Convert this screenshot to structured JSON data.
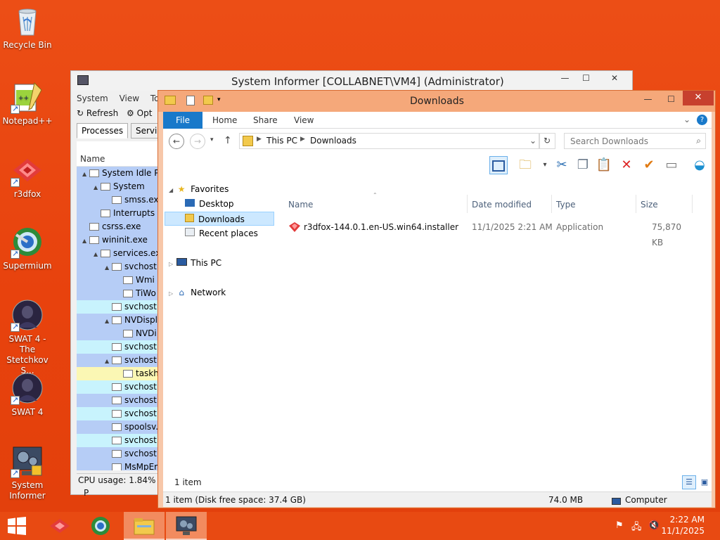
{
  "desktop": {
    "icons": [
      {
        "label": "Recycle Bin",
        "icon": "recycle-bin-icon"
      },
      {
        "label": "Notepad++",
        "icon": "notepad-plus-plus-icon"
      },
      {
        "label": "r3dfox",
        "icon": "r3dfox-icon"
      },
      {
        "label": "Supermium",
        "icon": "supermium-icon"
      },
      {
        "label": "SWAT 4 - The Stetchkov S...",
        "icon": "swat4-expansion-icon"
      },
      {
        "label": "SWAT 4",
        "icon": "swat4-icon"
      },
      {
        "label": "System Informer",
        "icon": "system-informer-icon"
      }
    ]
  },
  "system_informer": {
    "title": "System Informer [COLLABNET\\VM4] (Administrator)",
    "menu": [
      "System",
      "View",
      "Too"
    ],
    "toolbar": {
      "refresh": "Refresh",
      "options": "Opt"
    },
    "tabs": [
      "Processes",
      "Services"
    ],
    "column_name": "Name",
    "processes": [
      {
        "name": "System Idle Pr",
        "color": "blue",
        "indent": 0,
        "twisty": "▲"
      },
      {
        "name": "System",
        "color": "blue",
        "indent": 1,
        "twisty": "▲"
      },
      {
        "name": "smss.exe",
        "color": "blue",
        "indent": 2,
        "twisty": ""
      },
      {
        "name": "Interrupts",
        "color": "blue",
        "indent": 1,
        "twisty": ""
      },
      {
        "name": "csrss.exe",
        "color": "blue",
        "indent": 0,
        "twisty": ""
      },
      {
        "name": "wininit.exe",
        "color": "blue",
        "indent": 0,
        "twisty": "▲"
      },
      {
        "name": "services.exe",
        "color": "blue",
        "indent": 1,
        "twisty": "▲"
      },
      {
        "name": "svchost.",
        "color": "blue",
        "indent": 2,
        "twisty": "▲"
      },
      {
        "name": "Wmi",
        "color": "blue",
        "indent": 3,
        "twisty": ""
      },
      {
        "name": "TiWo",
        "color": "blue",
        "indent": 3,
        "twisty": ""
      },
      {
        "name": "svchost.",
        "color": "cyan",
        "indent": 2,
        "twisty": ""
      },
      {
        "name": "NVDispl",
        "color": "blue",
        "indent": 2,
        "twisty": "▲"
      },
      {
        "name": "NVDi",
        "color": "blue",
        "indent": 3,
        "twisty": ""
      },
      {
        "name": "svchost.",
        "color": "cyan",
        "indent": 2,
        "twisty": ""
      },
      {
        "name": "svchost.",
        "color": "blue",
        "indent": 2,
        "twisty": "▲"
      },
      {
        "name": "taskh",
        "color": "yellow",
        "indent": 3,
        "twisty": ""
      },
      {
        "name": "svchost.",
        "color": "cyan",
        "indent": 2,
        "twisty": ""
      },
      {
        "name": "svchost.",
        "color": "blue",
        "indent": 2,
        "twisty": ""
      },
      {
        "name": "svchost.",
        "color": "cyan",
        "indent": 2,
        "twisty": ""
      },
      {
        "name": "spoolsv.",
        "color": "blue",
        "indent": 2,
        "twisty": ""
      },
      {
        "name": "svchost.",
        "color": "cyan",
        "indent": 2,
        "twisty": ""
      },
      {
        "name": "svchost.",
        "color": "blue",
        "indent": 2,
        "twisty": ""
      },
      {
        "name": "MsMpEr",
        "color": "blue",
        "indent": 2,
        "twisty": ""
      }
    ],
    "status_cpu": "CPU usage: 1.84%",
    "status_extra": "P"
  },
  "explorer": {
    "title": "Downloads",
    "ribbon_tabs": {
      "file": "File",
      "home": "Home",
      "share": "Share",
      "view": "View"
    },
    "address": {
      "this_pc": "This PC",
      "downloads": "Downloads"
    },
    "search_placeholder": "Search Downloads",
    "nav": {
      "favorites": "Favorites",
      "desktop": "Desktop",
      "downloads": "Downloads",
      "recent": "Recent places",
      "this_pc": "This PC",
      "network": "Network"
    },
    "columns": {
      "name": "Name",
      "date": "Date modified",
      "type": "Type",
      "size": "Size"
    },
    "files": [
      {
        "name": "r3dfox-144.0.1.en-US.win64.installer",
        "date": "11/1/2025 2:21 AM",
        "type": "Application",
        "size": "75,870 KB"
      }
    ],
    "item_count": "1 item",
    "status": {
      "left": "1 item (Disk free space: 37.4 GB)",
      "size": "74.0 MB",
      "location": "Computer"
    }
  },
  "taskbar": {
    "clock_time": "2:22 AM",
    "clock_date": "11/1/2025"
  },
  "colors": {
    "desktop": "#e8420d",
    "explorer_frame": "#f5a87a",
    "close_red": "#c7402e",
    "file_tab": "#1979ca",
    "process_blue": "#b6cdf6",
    "process_cyan": "#c8f3fd",
    "process_yellow": "#fbf7b4"
  }
}
